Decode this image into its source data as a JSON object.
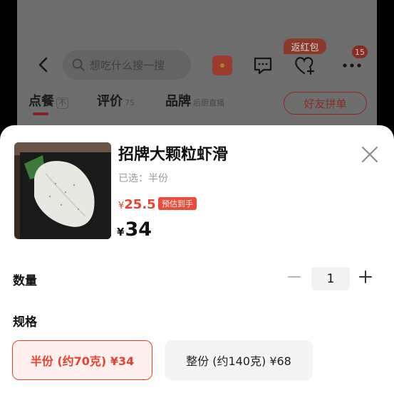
{
  "header": {
    "search_placeholder": "想吃什么搜一搜",
    "rebate_badge": "返红包",
    "notification_count": "15"
  },
  "tabs": [
    {
      "label": "点餐",
      "sub": "不"
    },
    {
      "label": "评价",
      "sub": "75"
    },
    {
      "label": "品牌",
      "sub": "后厨直播"
    }
  ],
  "group_button": "好友拼单",
  "product": {
    "title": "招牌大颗粒虾滑",
    "selected": "已选：半份",
    "est_yen": "¥",
    "est_price": "25.5",
    "est_badge": "预估到手",
    "yen": "¥",
    "price": "34"
  },
  "quantity": {
    "label": "数量",
    "value": "1"
  },
  "spec": {
    "label": "规格",
    "options": [
      {
        "label": "半份 (约70克) ¥34",
        "selected": true
      },
      {
        "label": "整份 (约140克) ¥68",
        "selected": false
      }
    ]
  },
  "colors": {
    "accent": "#e8412f",
    "badge_bg": "#ee4a35"
  },
  "icons": [
    "back-arrow-icon",
    "search-icon",
    "red-packet-icon",
    "message-icon",
    "heart-plus-icon",
    "more-icon",
    "close-icon",
    "minus-icon",
    "plus-icon"
  ]
}
